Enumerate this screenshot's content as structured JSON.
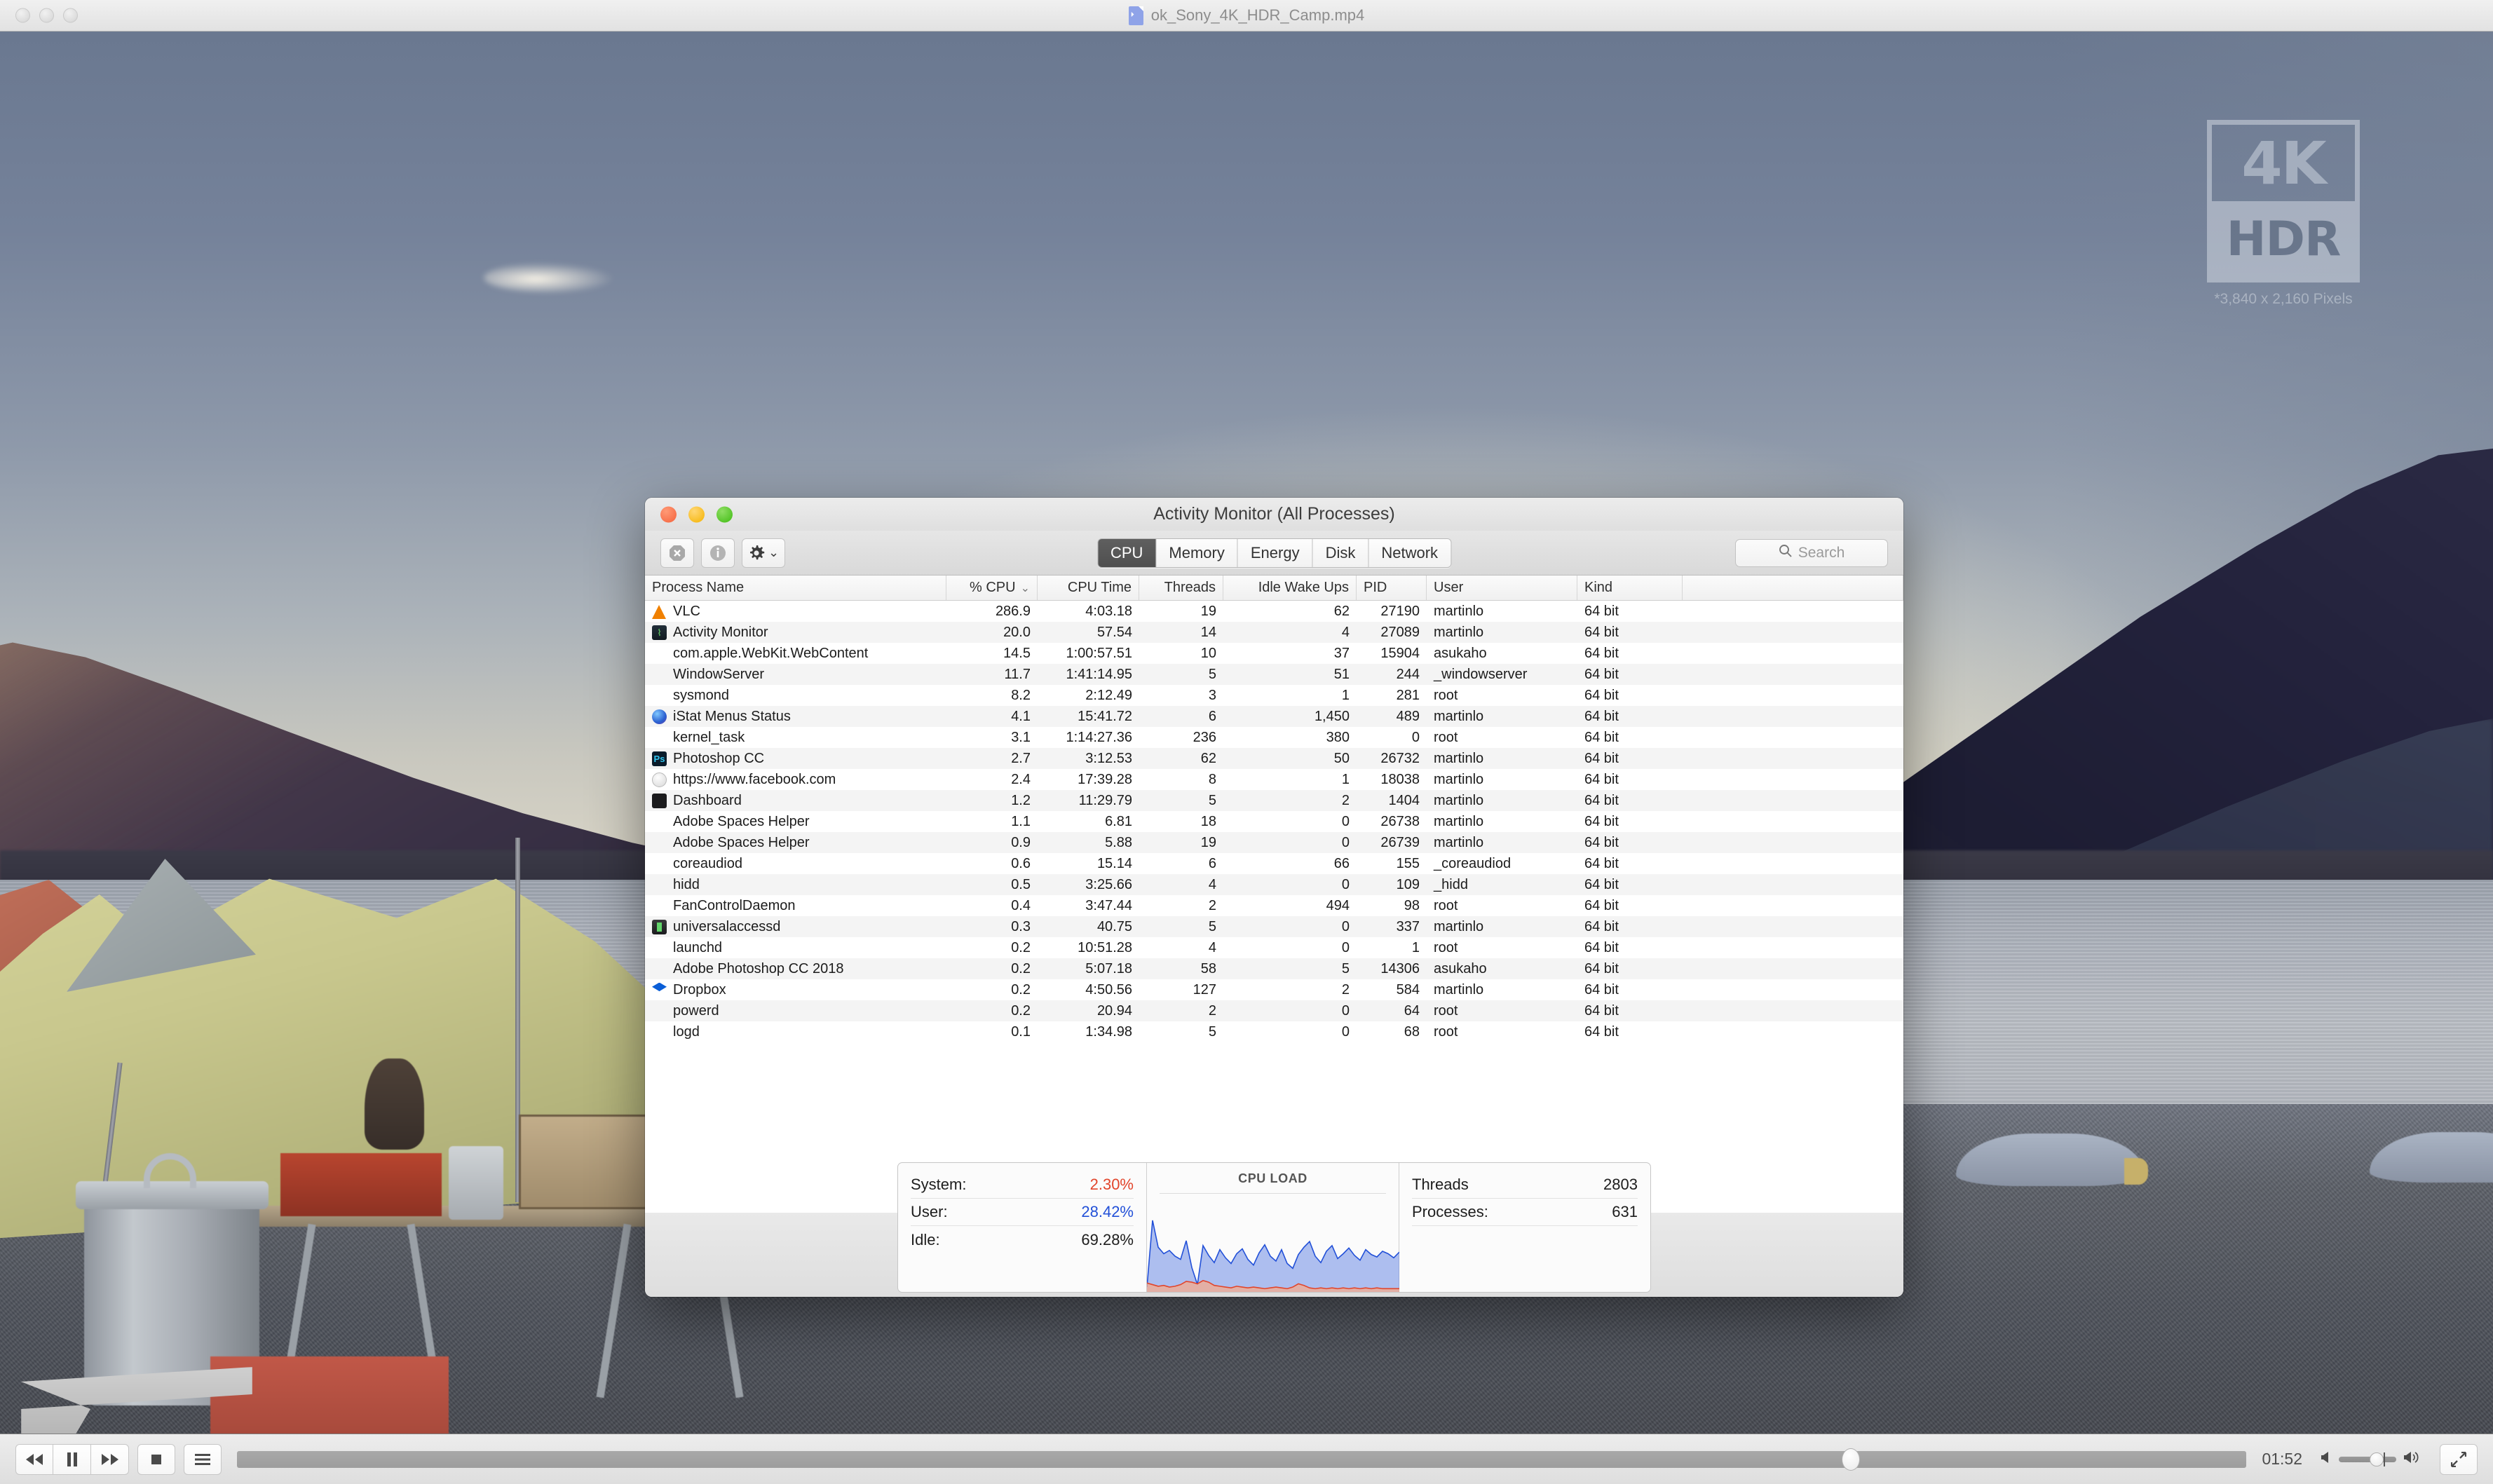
{
  "player": {
    "title": "ok_Sony_4K_HDR_Camp.mp4",
    "doc_icon": "video-file-icon",
    "lights": [
      "close",
      "minimize",
      "zoom"
    ],
    "controls": {
      "rewind_label": "◀◀",
      "pause_label": "▐▐",
      "forward_label": "▶▶",
      "stop_label": "■",
      "playlist_label": "≡",
      "time": "01:52",
      "volume_low_icon": "◀",
      "volume_high_icon": "◀‖",
      "fullscreen_icon": "⤡"
    },
    "watermark": {
      "k_label": "4K",
      "hdr_label": "HDR",
      "caption": "*3,840 x 2,160 Pixels"
    }
  },
  "activity_monitor": {
    "title": "Activity Monitor (All Processes)",
    "lights": [
      "close",
      "minimize",
      "zoom"
    ],
    "toolbar": {
      "quit_icon": "stop-process-icon",
      "info_icon": "inspect-process-icon",
      "gear_icon": "gear-icon",
      "gear_chevron": "⌄",
      "tabs": [
        {
          "label": "CPU",
          "active": true
        },
        {
          "label": "Memory",
          "active": false
        },
        {
          "label": "Energy",
          "active": false
        },
        {
          "label": "Disk",
          "active": false
        },
        {
          "label": "Network",
          "active": false
        }
      ],
      "search_placeholder": "Search",
      "search_value": ""
    },
    "columns": [
      "Process Name",
      "% CPU",
      "CPU Time",
      "Threads",
      "Idle Wake Ups",
      "PID",
      "User",
      "Kind"
    ],
    "sort_column": "% CPU",
    "sort_indicator": "⌄",
    "rows": [
      {
        "icon": "vlc",
        "name": "VLC",
        "cpu": "286.9",
        "time": "4:03.18",
        "threads": "19",
        "idle": "62",
        "pid": "27190",
        "user": "martinlo",
        "kind": "64 bit"
      },
      {
        "icon": "am",
        "name": "Activity Monitor",
        "cpu": "20.0",
        "time": "57.54",
        "threads": "14",
        "idle": "4",
        "pid": "27089",
        "user": "martinlo",
        "kind": "64 bit"
      },
      {
        "icon": "none",
        "name": "com.apple.WebKit.WebContent",
        "cpu": "14.5",
        "time": "1:00:57.51",
        "threads": "10",
        "idle": "37",
        "pid": "15904",
        "user": "asukaho",
        "kind": "64 bit"
      },
      {
        "icon": "none",
        "name": "WindowServer",
        "cpu": "11.7",
        "time": "1:41:14.95",
        "threads": "5",
        "idle": "51",
        "pid": "244",
        "user": "_windowserver",
        "kind": "64 bit"
      },
      {
        "icon": "none",
        "name": "sysmond",
        "cpu": "8.2",
        "time": "2:12.49",
        "threads": "3",
        "idle": "1",
        "pid": "281",
        "user": "root",
        "kind": "64 bit"
      },
      {
        "icon": "istat",
        "name": "iStat Menus Status",
        "cpu": "4.1",
        "time": "15:41.72",
        "threads": "6",
        "idle": "1,450",
        "pid": "489",
        "user": "martinlo",
        "kind": "64 bit"
      },
      {
        "icon": "none",
        "name": "kernel_task",
        "cpu": "3.1",
        "time": "1:14:27.36",
        "threads": "236",
        "idle": "380",
        "pid": "0",
        "user": "root",
        "kind": "64 bit"
      },
      {
        "icon": "ps",
        "name": "Photoshop CC",
        "cpu": "2.7",
        "time": "3:12.53",
        "threads": "62",
        "idle": "50",
        "pid": "26732",
        "user": "martinlo",
        "kind": "64 bit"
      },
      {
        "icon": "safari",
        "name": "https://www.facebook.com",
        "cpu": "2.4",
        "time": "17:39.28",
        "threads": "8",
        "idle": "1",
        "pid": "18038",
        "user": "martinlo",
        "kind": "64 bit"
      },
      {
        "icon": "dash",
        "name": "Dashboard",
        "cpu": "1.2",
        "time": "11:29.79",
        "threads": "5",
        "idle": "2",
        "pid": "1404",
        "user": "martinlo",
        "kind": "64 bit"
      },
      {
        "icon": "none",
        "name": "Adobe Spaces Helper",
        "cpu": "1.1",
        "time": "6.81",
        "threads": "18",
        "idle": "0",
        "pid": "26738",
        "user": "martinlo",
        "kind": "64 bit"
      },
      {
        "icon": "none",
        "name": "Adobe Spaces Helper",
        "cpu": "0.9",
        "time": "5.88",
        "threads": "19",
        "idle": "0",
        "pid": "26739",
        "user": "martinlo",
        "kind": "64 bit"
      },
      {
        "icon": "none",
        "name": "coreaudiod",
        "cpu": "0.6",
        "time": "15.14",
        "threads": "6",
        "idle": "66",
        "pid": "155",
        "user": "_coreaudiod",
        "kind": "64 bit"
      },
      {
        "icon": "none",
        "name": "hidd",
        "cpu": "0.5",
        "time": "3:25.66",
        "threads": "4",
        "idle": "0",
        "pid": "109",
        "user": "_hidd",
        "kind": "64 bit"
      },
      {
        "icon": "none",
        "name": "FanControlDaemon",
        "cpu": "0.4",
        "time": "3:47.44",
        "threads": "2",
        "idle": "494",
        "pid": "98",
        "user": "root",
        "kind": "64 bit"
      },
      {
        "icon": "univ",
        "name": "universalaccessd",
        "cpu": "0.3",
        "time": "40.75",
        "threads": "5",
        "idle": "0",
        "pid": "337",
        "user": "martinlo",
        "kind": "64 bit"
      },
      {
        "icon": "none",
        "name": "launchd",
        "cpu": "0.2",
        "time": "10:51.28",
        "threads": "4",
        "idle": "0",
        "pid": "1",
        "user": "root",
        "kind": "64 bit"
      },
      {
        "icon": "none",
        "name": "Adobe Photoshop CC 2018",
        "cpu": "0.2",
        "time": "5:07.18",
        "threads": "58",
        "idle": "5",
        "pid": "14306",
        "user": "asukaho",
        "kind": "64 bit"
      },
      {
        "icon": "dropbox",
        "name": "Dropbox",
        "cpu": "0.2",
        "time": "4:50.56",
        "threads": "127",
        "idle": "2",
        "pid": "584",
        "user": "martinlo",
        "kind": "64 bit"
      },
      {
        "icon": "none",
        "name": "powerd",
        "cpu": "0.2",
        "time": "20.94",
        "threads": "2",
        "idle": "0",
        "pid": "64",
        "user": "root",
        "kind": "64 bit"
      },
      {
        "icon": "none",
        "name": "logd",
        "cpu": "0.1",
        "time": "1:34.98",
        "threads": "5",
        "idle": "0",
        "pid": "68",
        "user": "root",
        "kind": "64 bit"
      }
    ],
    "footer": {
      "system_label": "System:",
      "system_value": "2.30%",
      "user_label": "User:",
      "user_value": "28.42%",
      "idle_label": "Idle:",
      "idle_value": "69.28%",
      "graph_title": "CPU LOAD",
      "threads_label": "Threads",
      "threads_value": "2803",
      "processes_label": "Processes:",
      "processes_value": "631",
      "color_system": "#e2452b",
      "color_user": "#2250d8"
    }
  },
  "chart_data": {
    "type": "area",
    "title": "CPU LOAD",
    "xlabel": "",
    "ylabel": "",
    "ylim": [
      0,
      100
    ],
    "grid": false,
    "legend": "none",
    "series": [
      {
        "name": "User",
        "color": "#2250d8",
        "values": [
          6,
          88,
          55,
          47,
          51,
          44,
          40,
          63,
          30,
          9,
          57,
          45,
          36,
          52,
          42,
          35,
          47,
          53,
          40,
          33,
          48,
          58,
          44,
          38,
          52,
          35,
          29,
          46,
          55,
          62,
          44,
          36,
          50,
          57,
          41,
          47,
          54,
          45,
          39,
          52,
          46,
          43,
          50,
          47,
          42,
          49
        ]
      },
      {
        "name": "System",
        "color": "#e2452b",
        "values": [
          11,
          9,
          7,
          8,
          6,
          7,
          9,
          13,
          12,
          10,
          14,
          12,
          8,
          7,
          6,
          5,
          7,
          6,
          5,
          6,
          5,
          4,
          5,
          6,
          5,
          4,
          6,
          10,
          8,
          5,
          4,
          5,
          4,
          5,
          4,
          5,
          4,
          5,
          4,
          5,
          4,
          5,
          4,
          4,
          4,
          4
        ]
      }
    ]
  }
}
